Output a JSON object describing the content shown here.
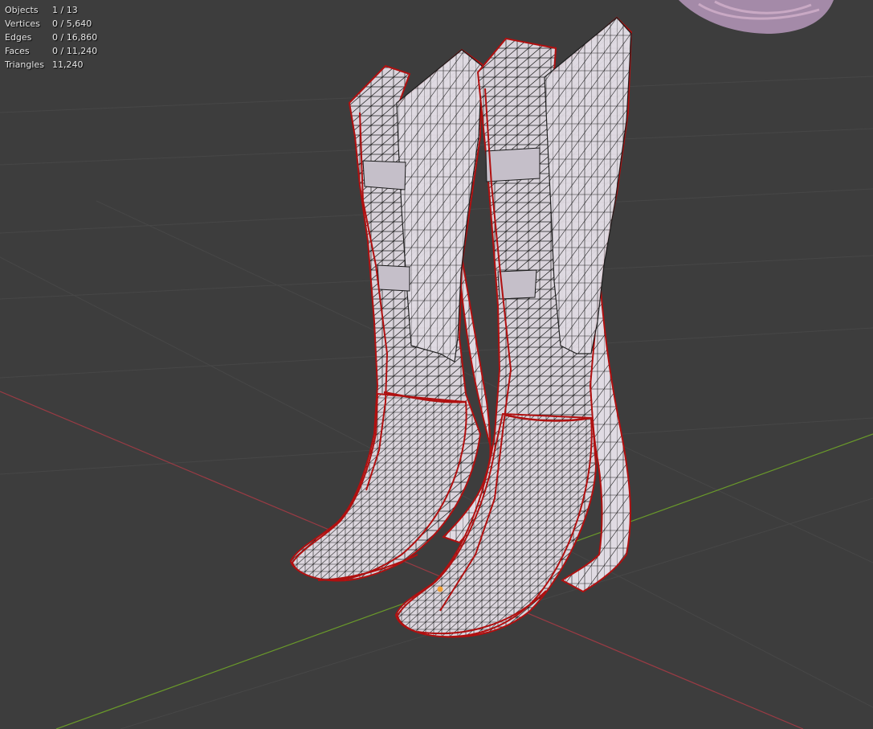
{
  "viewport": {
    "background": "#3d3d3d",
    "grid_color": "#474747",
    "x_axis_color": "#9a3b44",
    "y_axis_color": "#6a9a2a",
    "mesh_fill": "#d8d2da",
    "mesh_edge_color": "#1e1e1e",
    "seam_color": "#b01010",
    "hair_color": "#a48aa8"
  },
  "stats": {
    "objects": {
      "label": "Objects",
      "value": "1 / 13"
    },
    "vertices": {
      "label": "Vertices",
      "value": "0 / 5,640"
    },
    "edges": {
      "label": "Edges",
      "value": "0 / 16,860"
    },
    "faces": {
      "label": "Faces",
      "value": "0 / 11,240"
    },
    "triangles": {
      "label": "Triangles",
      "value": "11,240"
    }
  }
}
